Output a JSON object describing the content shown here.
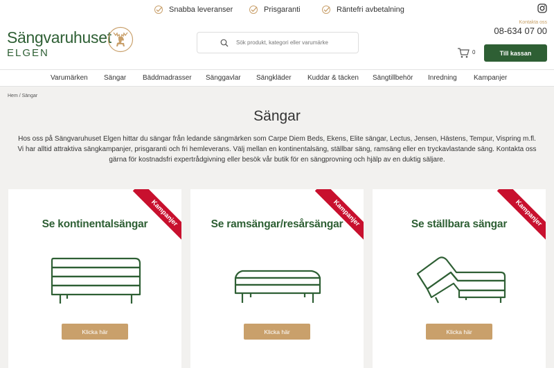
{
  "topbar": {
    "usps": [
      "Snabba leveranser",
      "Prisgaranti",
      "Räntefri avbetalning"
    ]
  },
  "header": {
    "logo_main": "Sängvaruhuset",
    "logo_sub": "ELGEN",
    "search_placeholder": "Sök produkt, kategori eller varumärke",
    "contact_label": "Kontakta oss",
    "phone": "08-634 07 00",
    "cart_count": "0",
    "checkout_label": "Till kassan"
  },
  "nav": [
    "Varumärken",
    "Sängar",
    "Bäddmadrasser",
    "Sänggavlar",
    "Sängkläder",
    "Kuddar & täcken",
    "Sängtillbehör",
    "Inredning",
    "Kampanjer"
  ],
  "breadcrumb": "Hem / Sängar",
  "page_title": "Sängar",
  "intro": "Hos oss på Sängvaruhuset Elgen hittar du sängar från ledande sängmärken som Carpe Diem Beds, Ekens, Elite sängar, Lectus, Jensen, Hästens, Tempur, Vispring m.fl. Vi har alltid attraktiva sängkampanjer, prisgaranti och fri hemleverans. Välj mellan en kontinentalsäng, ställbar säng, ramsäng eller en tryckavlastande säng. Kontakta oss gärna för kostnadsfri expertrådgivning eller besök vår butik för en sängprovning och hjälp av en duktig säljare.",
  "cards": [
    {
      "title": "Se kontinentalsängar",
      "ribbon": "Kampanjer",
      "button": "Klicka här"
    },
    {
      "title": "Se ramsängar/resårsängar",
      "ribbon": "Kampanjer",
      "button": "Klicka här"
    },
    {
      "title": "Se ställbara sängar",
      "ribbon": "Kampanjer",
      "button": "Klicka här"
    }
  ],
  "colors": {
    "brand_green": "#2e5f34",
    "gold": "#c9a06b",
    "ribbon_red": "#c8102e"
  }
}
